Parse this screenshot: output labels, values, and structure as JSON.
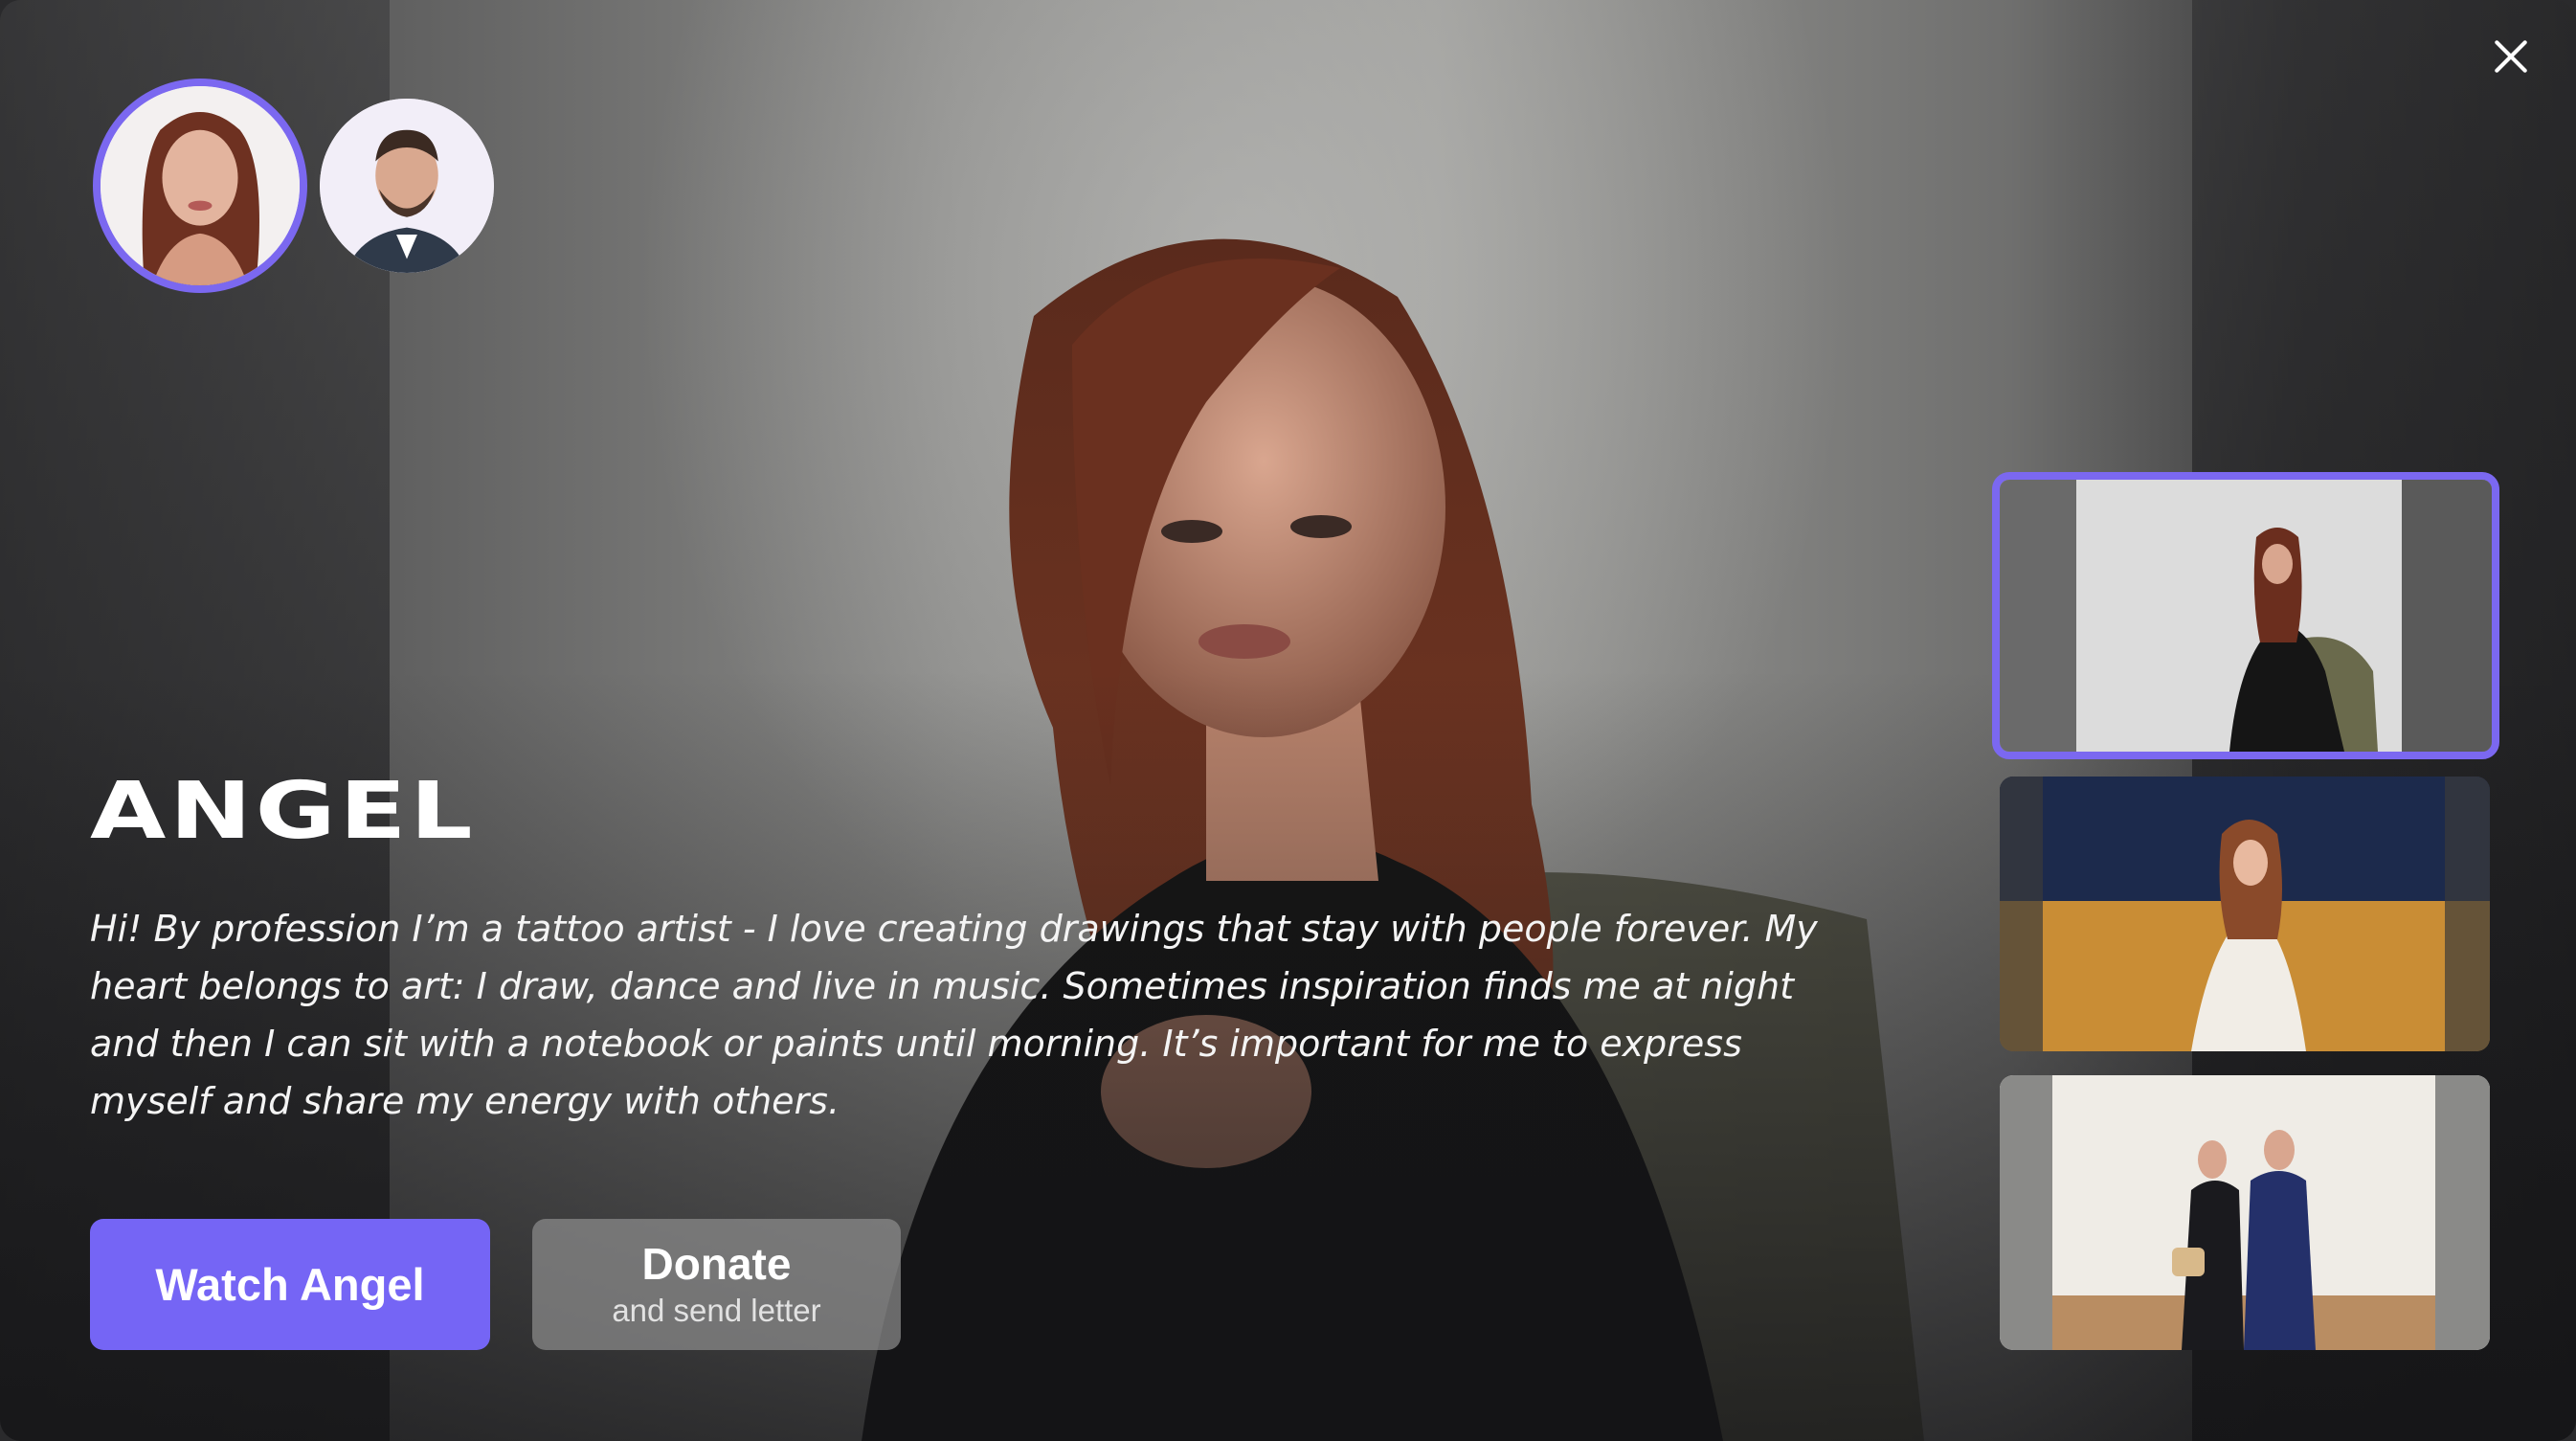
{
  "profile": {
    "name": "ANGEL",
    "bio": "Hi! By profession I’m a tattoo artist - I love creating drawings that stay with people forever. My heart belongs to art: I draw, dance and live in music. Sometimes inspiration finds me at night and then I can sit with a notebook or paints until morning. It’s important for me to express myself and share my energy with others."
  },
  "avatars": [
    {
      "icon": "avatar-woman",
      "selected": true
    },
    {
      "icon": "avatar-man",
      "selected": false
    }
  ],
  "actions": {
    "watch_label": "Watch Angel",
    "donate_label": "Donate",
    "donate_sub_label": "and send letter"
  },
  "gallery": [
    {
      "scene": "studio-seated-portrait",
      "selected": true
    },
    {
      "scene": "beach-sunset-portrait",
      "selected": false
    },
    {
      "scene": "couple-indoor-photo",
      "selected": false
    }
  ],
  "controls": {
    "close_icon": "close-icon"
  },
  "colors": {
    "accent": "#7565f5",
    "selection_ring": "#7b68f0",
    "text": "#ffffff"
  }
}
